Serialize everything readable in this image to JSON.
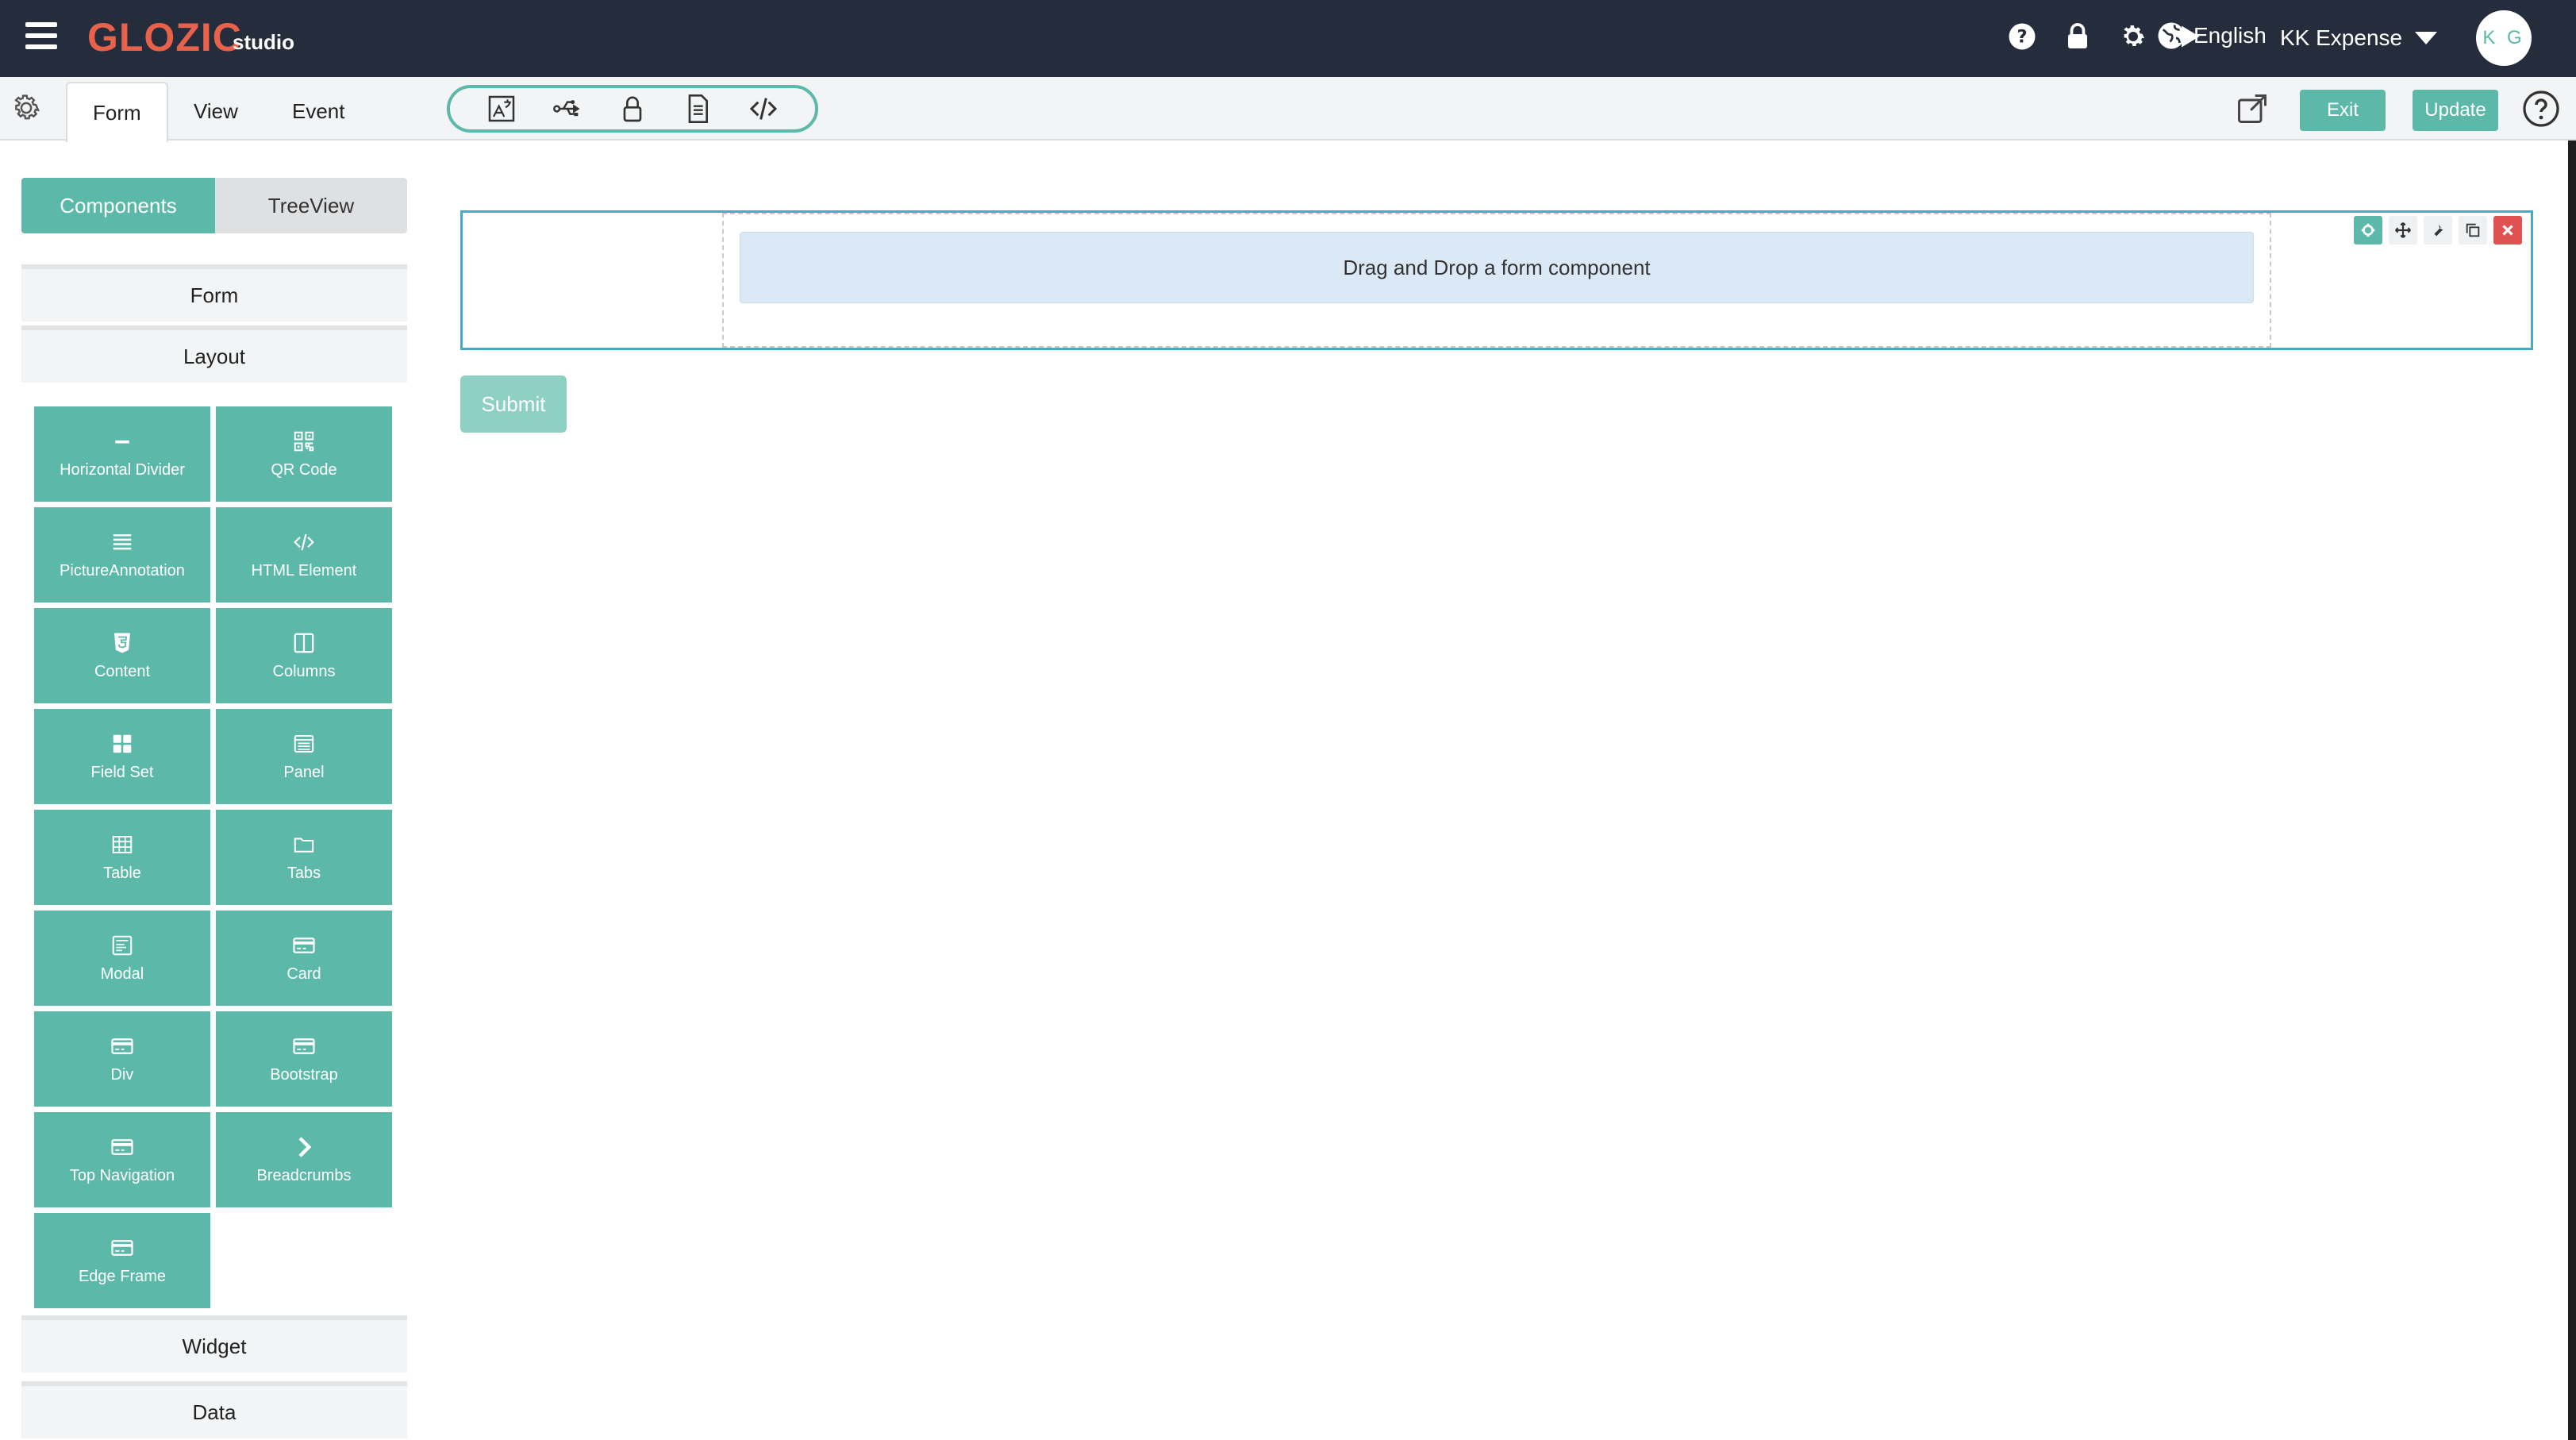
{
  "app": {
    "logo_main": "GLOZIC",
    "logo_sub": "studio",
    "language": "English",
    "project": "KK Expense",
    "avatar_initials": "K G"
  },
  "top_icons": [
    "help-icon",
    "lock-icon",
    "gear-icon",
    "play-icon",
    "globe-icon"
  ],
  "tabs": [
    {
      "label": "Form",
      "active": true
    },
    {
      "label": "View",
      "active": false
    },
    {
      "label": "Event",
      "active": false
    }
  ],
  "toolbar_icons": [
    "image-translate-icon",
    "usb-icon",
    "lock-icon",
    "document-icon",
    "code-icon"
  ],
  "actions": {
    "exit_label": "Exit",
    "update_label": "Update"
  },
  "sidebar": {
    "segment_on": "Components",
    "segment_off": "TreeView",
    "groups": {
      "form": "Form",
      "layout": "Layout",
      "widget": "Widget",
      "data": "Data"
    },
    "components": [
      {
        "label": "Horizontal Divider",
        "icon": "minus-icon"
      },
      {
        "label": "QR Code",
        "icon": "qr-code-icon"
      },
      {
        "label": "PictureAnnotation",
        "icon": "list-lines-icon"
      },
      {
        "label": "HTML Element",
        "icon": "code-icon"
      },
      {
        "label": "Content",
        "icon": "html5-icon"
      },
      {
        "label": "Columns",
        "icon": "columns-icon"
      },
      {
        "label": "Field Set",
        "icon": "grid-icon"
      },
      {
        "label": "Panel",
        "icon": "panel-icon"
      },
      {
        "label": "Table",
        "icon": "table-icon"
      },
      {
        "label": "Tabs",
        "icon": "folder-icon"
      },
      {
        "label": "Modal",
        "icon": "modal-icon"
      },
      {
        "label": "Card",
        "icon": "card-icon"
      },
      {
        "label": "Div",
        "icon": "card-icon"
      },
      {
        "label": "Bootstrap",
        "icon": "card-icon"
      },
      {
        "label": "Top Navigation",
        "icon": "card-icon"
      },
      {
        "label": "Breadcrumbs",
        "icon": "chevron-right-icon"
      },
      {
        "label": "Edge Frame",
        "icon": "card-icon"
      }
    ]
  },
  "canvas": {
    "dropzone_text": "Drag and Drop a form component",
    "submit_label": "Submit"
  },
  "colors": {
    "topbar": "#252d3d",
    "accent": "#5cb8a8",
    "logo": "#e8614a",
    "form_border": "#4aa9c9",
    "delete": "#e05252"
  }
}
